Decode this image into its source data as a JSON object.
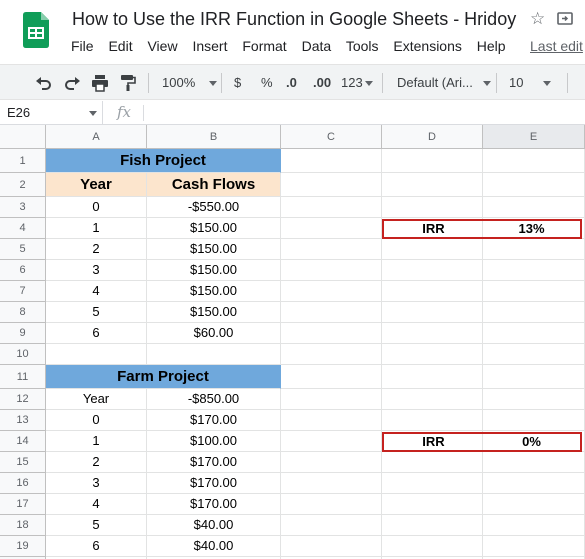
{
  "app": {
    "title": "How to Use the IRR Function in Google Sheets - Hridoy",
    "last_edit": "Last edit"
  },
  "menu": [
    "File",
    "Edit",
    "View",
    "Insert",
    "Format",
    "Data",
    "Tools",
    "Extensions",
    "Help"
  ],
  "toolbar": {
    "zoom": "100%",
    "currency": "$",
    "percent": "%",
    "decrease_decimal": ".0",
    "increase_decimal": ".00",
    "more_formats": "123",
    "font": "Default (Ari...",
    "font_size": "10"
  },
  "formula_bar": {
    "cell_ref": "E26",
    "fx": "fx",
    "content": ""
  },
  "columns": [
    "A",
    "B",
    "C",
    "D",
    "E"
  ],
  "rows": [
    "1",
    "2",
    "3",
    "4",
    "5",
    "6",
    "7",
    "8",
    "9",
    "10",
    "11",
    "12",
    "13",
    "14",
    "15",
    "16",
    "17",
    "18",
    "19"
  ],
  "fish_project": {
    "title": "Fish Project",
    "col_year": "Year",
    "col_cash": "Cash Flows",
    "years": [
      "0",
      "1",
      "2",
      "3",
      "4",
      "5",
      "6"
    ],
    "cash_flows": [
      "-$550.00",
      "$150.00",
      "$150.00",
      "$150.00",
      "$150.00",
      "$150.00",
      "$60.00"
    ],
    "irr_label": "IRR",
    "irr_value": "13%"
  },
  "farm_project": {
    "title": "Farm Project",
    "col_year": "Year",
    "first_cash": "-$850.00",
    "years": [
      "0",
      "1",
      "2",
      "3",
      "4",
      "5",
      "6"
    ],
    "cash_flows": [
      "$170.00",
      "$100.00",
      "$170.00",
      "$170.00",
      "$170.00",
      "$40.00",
      "$40.00"
    ],
    "irr_label": "IRR",
    "irr_value": "0%"
  },
  "colors": {
    "header_blue": "#6fa8dc",
    "header_peach": "#fce5cd",
    "highlight_red": "#c5221f",
    "sheets_green": "#0f9d58"
  }
}
